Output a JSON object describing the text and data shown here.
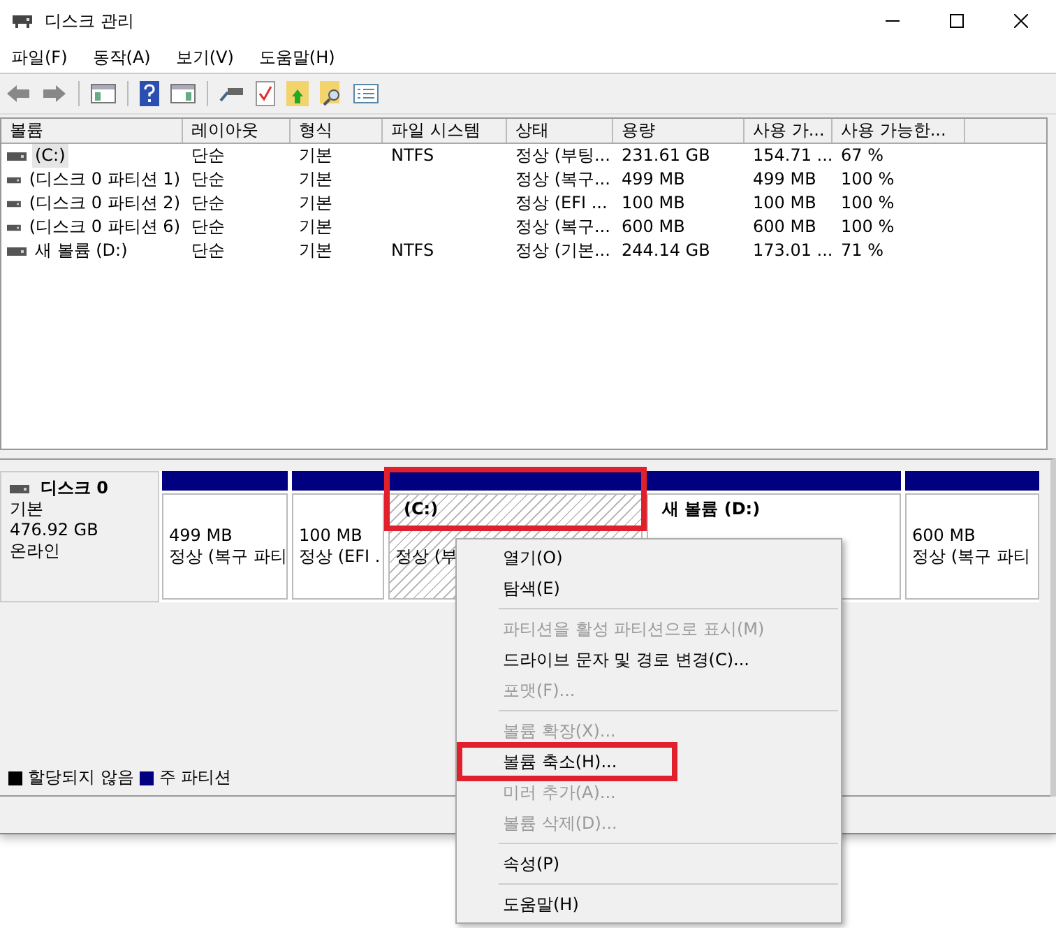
{
  "window": {
    "title": "디스크 관리"
  },
  "menu_bar": [
    "파일(F)",
    "동작(A)",
    "보기(V)",
    "도움말(H)"
  ],
  "volume_table": {
    "columns": [
      "볼륨",
      "레이아웃",
      "형식",
      "파일 시스템",
      "상태",
      "용량",
      "사용 가...",
      "사용 가능한..."
    ],
    "rows": [
      {
        "selected": true,
        "cells": [
          "(C:)",
          "단순",
          "기본",
          "NTFS",
          "정상 (부팅...",
          "231.61 GB",
          "154.71 ...",
          "67 %"
        ]
      },
      {
        "selected": false,
        "cells": [
          "(디스크 0 파티션 1)",
          "단순",
          "기본",
          "",
          "정상 (복구...",
          "499 MB",
          "499 MB",
          "100 %"
        ]
      },
      {
        "selected": false,
        "cells": [
          "(디스크 0 파티션 2)",
          "단순",
          "기본",
          "",
          "정상 (EFI ...",
          "100 MB",
          "100 MB",
          "100 %"
        ]
      },
      {
        "selected": false,
        "cells": [
          "(디스크 0 파티션 6)",
          "단순",
          "기본",
          "",
          "정상 (복구...",
          "600 MB",
          "600 MB",
          "100 %"
        ]
      },
      {
        "selected": false,
        "cells": [
          "새 볼륨 (D:)",
          "단순",
          "기본",
          "NTFS",
          "정상 (기본...",
          "244.14 GB",
          "173.01 ...",
          "71 %"
        ]
      }
    ]
  },
  "disk": {
    "name": "디스크 0",
    "type": "기본",
    "size": "476.92 GB",
    "status": "온라인",
    "partitions": [
      {
        "lines": [
          "499 MB",
          "정상 (복구 파티"
        ],
        "hatched": false,
        "highlighted": false
      },
      {
        "lines": [
          "100 MB",
          "정상 (EFI ."
        ],
        "hatched": false,
        "highlighted": false
      },
      {
        "name": "(C:)",
        "lines": [
          "정상 (부"
        ],
        "hatched": true,
        "highlighted": true
      },
      {
        "name": "새 볼륨  (D:)",
        "hatched": false,
        "highlighted": false
      },
      {
        "lines": [
          "600 MB",
          "정상 (복구 파티"
        ],
        "hatched": false,
        "highlighted": false
      }
    ]
  },
  "legend": [
    {
      "label": "할당되지 않음",
      "color": "#000000"
    },
    {
      "label": "주 파티션",
      "color": "#000080"
    }
  ],
  "context_menu": [
    {
      "kind": "item",
      "label": "열기(O)",
      "disabled": false,
      "highlighted": false
    },
    {
      "kind": "item",
      "label": "탐색(E)",
      "disabled": false,
      "highlighted": false
    },
    {
      "kind": "separator"
    },
    {
      "kind": "item",
      "label": "파티션을 활성 파티션으로 표시(M)",
      "disabled": true,
      "highlighted": false
    },
    {
      "kind": "item",
      "label": "드라이브 문자 및 경로 변경(C)...",
      "disabled": false,
      "highlighted": false
    },
    {
      "kind": "item",
      "label": "포맷(F)...",
      "disabled": true,
      "highlighted": false
    },
    {
      "kind": "separator"
    },
    {
      "kind": "item",
      "label": "볼륨 확장(X)...",
      "disabled": true,
      "highlighted": false
    },
    {
      "kind": "item",
      "label": "볼륨 축소(H)...",
      "disabled": false,
      "highlighted": true
    },
    {
      "kind": "item",
      "label": "미러 추가(A)...",
      "disabled": true,
      "highlighted": false
    },
    {
      "kind": "item",
      "label": "볼륨 삭제(D)...",
      "disabled": true,
      "highlighted": false
    },
    {
      "kind": "separator"
    },
    {
      "kind": "item",
      "label": "속성(P)",
      "disabled": false,
      "highlighted": false
    },
    {
      "kind": "separator"
    },
    {
      "kind": "item",
      "label": "도움말(H)",
      "disabled": false,
      "highlighted": false
    }
  ]
}
